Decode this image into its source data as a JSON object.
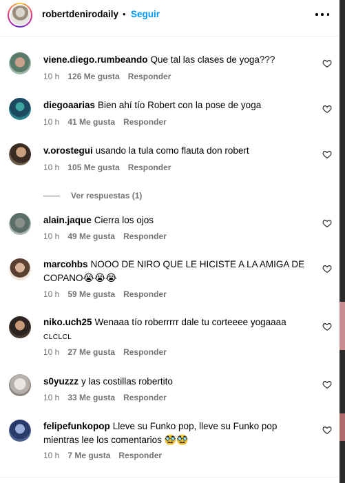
{
  "header": {
    "username": "robertdenirodaily",
    "separator": "•",
    "follow_label": "Seguir"
  },
  "colors": {
    "accent": "#0095f6",
    "meta_text": "#737373"
  },
  "comments": [
    {
      "username": "viene.diego.rumbeando",
      "text": "Que tal las clases de yoga???",
      "time": "10 h",
      "likes": "126 Me gusta",
      "reply": "Responder"
    },
    {
      "username": "diegoaarias",
      "text": "Bien ahí tío Robert con la pose de yoga",
      "time": "10 h",
      "likes": "41 Me gusta",
      "reply": "Responder"
    },
    {
      "username": "v.orostegui",
      "text": "usando la tula como flauta don robert",
      "time": "10 h",
      "likes": "105 Me gusta",
      "reply": "Responder",
      "replies_label": "Ver respuestas (1)"
    },
    {
      "username": "alain.jaque",
      "text": "Cierra los ojos",
      "time": "10 h",
      "likes": "49 Me gusta",
      "reply": "Responder"
    },
    {
      "username": "marcohbs",
      "text": "NOOO DE NIRO QUE LE HICISTE A LA AMIGA DE COPANO",
      "emojis": "😭😭😭",
      "time": "10 h",
      "likes": "59 Me gusta",
      "reply": "Responder"
    },
    {
      "username": "niko.uch25",
      "text": "Wenaaa tío roberrrrr dale tu corteeee yogaaaa",
      "suffix": "CLCLCL",
      "time": "10 h",
      "likes": "27 Me gusta",
      "reply": "Responder"
    },
    {
      "username": "s0yuzzz",
      "text": "y las costillas robertito",
      "time": "10 h",
      "likes": "33 Me gusta",
      "reply": "Responder"
    },
    {
      "username": "felipefunkopop",
      "text": "Lleve su Funko pop, lleve su Funko pop mientras lee los comentarios",
      "emojis": "🥸🥸",
      "time": "10 h",
      "likes": "7 Me gusta",
      "reply": "Responder"
    }
  ]
}
